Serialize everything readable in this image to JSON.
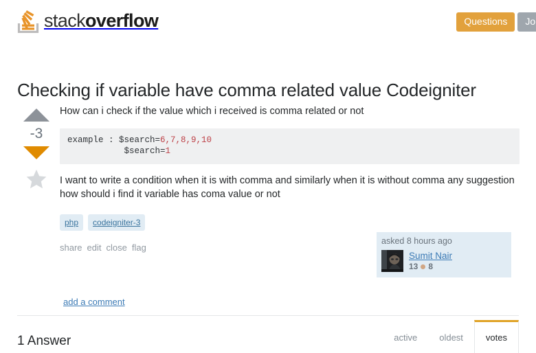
{
  "header": {
    "logo": {
      "text_light": "stack",
      "text_bold": "overflow",
      "icon": "stack-overflow-logo-icon"
    },
    "nav": [
      {
        "label": "Questions",
        "active": true
      },
      {
        "label": "Job",
        "active": false
      }
    ]
  },
  "question": {
    "title": "Checking if variable have comma related value Codeigniter",
    "votes": {
      "score": "-3",
      "upvote_icon": "arrow-up-icon",
      "downvote_icon": "arrow-down-icon",
      "favorite_icon": "star-icon"
    },
    "body": {
      "paragraph_1": "How can i check if the value which i received is comma related or not",
      "code": {
        "line1_label": "example : $search=",
        "line1_values": "6,7,8,9,10",
        "line2_label": "$search=",
        "line2_values": "1"
      },
      "paragraph_2": "I want to write a condition when it is with comma and similarly when it is without comma any suggestion how should i find it variable has coma value or not"
    },
    "tags": [
      "php",
      "codeigniter-3"
    ],
    "actions": [
      "share",
      "edit",
      "close",
      "flag"
    ],
    "owner_card": {
      "asked": "asked 8 hours ago",
      "username": "Sumit Nair",
      "reputation": "13",
      "badge_bronze_count": "8",
      "avatar_alt": "avatar"
    },
    "add_comment": "add a comment"
  },
  "answers": {
    "count_label": "1 Answer",
    "sort_tabs": [
      {
        "label": "active",
        "active": false
      },
      {
        "label": "oldest",
        "active": false
      },
      {
        "label": "votes",
        "active": true
      }
    ]
  },
  "colors": {
    "accent_orange": "#e0a224",
    "downvote_orange": "#e08b00",
    "tab_gray": "#9fa6ad",
    "link_blue": "#3b7ab5",
    "tag_bg": "#e1ecf4",
    "code_bg": "#eff0f1"
  }
}
